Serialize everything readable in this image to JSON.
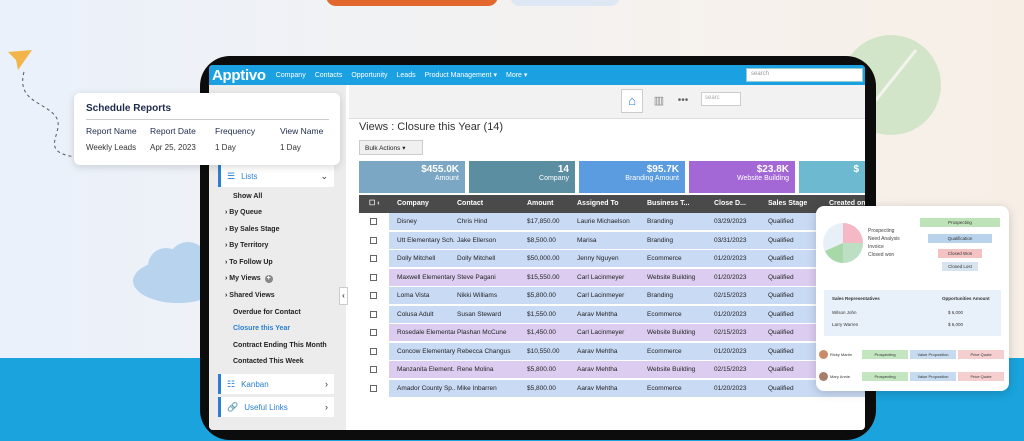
{
  "app": {
    "name": "Apptivo"
  },
  "topnav": {
    "items": [
      "Company",
      "Contacts",
      "Opportunity",
      "Leads",
      "Product Management ▾",
      "More ▾"
    ],
    "search_placeholder": "search"
  },
  "subbar": {
    "search_placeholder": "searc"
  },
  "sidebar": {
    "lists_label": "Lists",
    "items": [
      {
        "label": "Show All",
        "style": "bold"
      },
      {
        "label": "By Queue",
        "style": "bold",
        "chevron": true
      },
      {
        "label": "By Sales Stage",
        "style": "bold",
        "chevron": true
      },
      {
        "label": "By Territory",
        "style": "bold",
        "chevron": true
      },
      {
        "label": "To Follow Up",
        "style": "bold",
        "chevron": true
      },
      {
        "label": "My Views",
        "style": "bold",
        "chevron": true,
        "plus": true
      },
      {
        "label": "Shared Views",
        "style": "bold",
        "chevron": true
      },
      {
        "label": "Overdue for Contact",
        "style": "bold"
      },
      {
        "label": "Closure this Year",
        "style": "active"
      },
      {
        "label": "Contract Ending This Month",
        "style": "bold"
      },
      {
        "label": "Contacted This Week",
        "style": "bold"
      }
    ],
    "kanban_label": "Kanban",
    "useful_links_label": "Useful Links"
  },
  "view": {
    "title": "Views : Closure this Year (14)",
    "bulk_actions": "Bulk Actions",
    "tiles": [
      {
        "value": "$455.0K",
        "label": "Amount",
        "color": "#7ba7c4"
      },
      {
        "value": "14",
        "label": "Company",
        "color": "#5b8ea0"
      },
      {
        "value": "$95.7K",
        "label": "Branding Amount",
        "color": "#5b9bdf"
      },
      {
        "value": "$23.8K",
        "label": "Website Building",
        "color": "#a468d6"
      },
      {
        "value": "$",
        "label": "",
        "color": "#6dbad0"
      }
    ]
  },
  "table": {
    "columns": [
      "Company",
      "Contact",
      "Amount",
      "Assigned To",
      "Business T...",
      "Close D...",
      "Sales Stage",
      "Created on"
    ],
    "rows": [
      {
        "company": "Disney",
        "contact": "Chris Hind",
        "amount": "$17,850.00",
        "assigned": "Laurie Michaelson",
        "business": "Branding",
        "close": "03/29/2023",
        "stage": "Qualified",
        "color": "#c9daf5"
      },
      {
        "company": "Utt Elementary Sch...",
        "contact": "Jake Ellerson",
        "amount": "$8,500.00",
        "assigned": "Marisa",
        "business": "Branding",
        "close": "03/31/2023",
        "stage": "Qualified",
        "color": "#c9daf5"
      },
      {
        "company": "Dolly Mitchell",
        "contact": "Dolly Mitchell",
        "amount": "$50,000.00",
        "assigned": "Jenny Nguyen",
        "business": "Ecommerce",
        "close": "01/20/2023",
        "stage": "Qualified",
        "color": "#c9daf5"
      },
      {
        "company": "Maxwell Elementary",
        "contact": "Steve Pagani",
        "amount": "$15,550.00",
        "assigned": "Carl Lacinmeyer",
        "business": "Website Building",
        "close": "01/20/2023",
        "stage": "Qualified",
        "color": "#dccdf0"
      },
      {
        "company": "Loma Vista",
        "contact": "Nikki Williams",
        "amount": "$5,800.00",
        "assigned": "Carl Lacinmeyer",
        "business": "Branding",
        "close": "02/15/2023",
        "stage": "Qualified",
        "color": "#c9daf5"
      },
      {
        "company": "Colusa Adult",
        "contact": "Susan Steward",
        "amount": "$1,550.00",
        "assigned": "Aarav Mehtha",
        "business": "Ecommerce",
        "close": "01/20/2023",
        "stage": "Qualified",
        "color": "#c9daf5"
      },
      {
        "company": "Rosedale Elementary",
        "contact": "Plashan McCune",
        "amount": "$1,450.00",
        "assigned": "Carl Lacinmeyer",
        "business": "Website Building",
        "close": "02/15/2023",
        "stage": "Qualified",
        "color": "#dccdf0"
      },
      {
        "company": "Concow Elementary",
        "contact": "Rebecca Changus",
        "amount": "$10,550.00",
        "assigned": "Aarav Mehtha",
        "business": "Ecommerce",
        "close": "01/20/2023",
        "stage": "Qualified",
        "color": "#c9daf5"
      },
      {
        "company": "Manzanita Element...",
        "contact": "Rene Molina",
        "amount": "$5,800.00",
        "assigned": "Aarav Mehtha",
        "business": "Website Building",
        "close": "02/15/2023",
        "stage": "Qualified",
        "color": "#dccdf0"
      },
      {
        "company": "Amador County Sp...",
        "contact": "Mike Inbarren",
        "amount": "$5,800.00",
        "assigned": "Aarav Mehtha",
        "business": "Ecommerce",
        "close": "01/20/2023",
        "stage": "Qualified",
        "color": "#c9daf5"
      }
    ]
  },
  "schedule": {
    "title": "Schedule Reports",
    "headers": [
      "Report Name",
      "Report Date",
      "Frequency",
      "View Name"
    ],
    "values": [
      "Weekly Leads",
      "Apr 25, 2023",
      "1 Day",
      "1 Day"
    ]
  },
  "pipeline": {
    "legend": [
      "Prospecting",
      "Need Analysis",
      "Invoice",
      "Closed won"
    ],
    "funnel": [
      "Prospecting",
      "Qualification",
      "Closed Won",
      "Closed Lost"
    ],
    "rep_header": [
      "Sales Representatives",
      "Opportunities Amount"
    ],
    "reps": [
      {
        "name": "Wilson John",
        "amount": "$ 6,000"
      },
      {
        "name": "Larry Warren",
        "amount": "$ 6,000"
      }
    ],
    "people": [
      {
        "name": "Ricky Martin",
        "stages": [
          "Prospecting",
          "Value Proposition",
          "Price Quote"
        ]
      },
      {
        "name": "Mary Annie",
        "stages": [
          "Prospecting",
          "Value Proposition",
          "Price Quote"
        ]
      }
    ]
  }
}
